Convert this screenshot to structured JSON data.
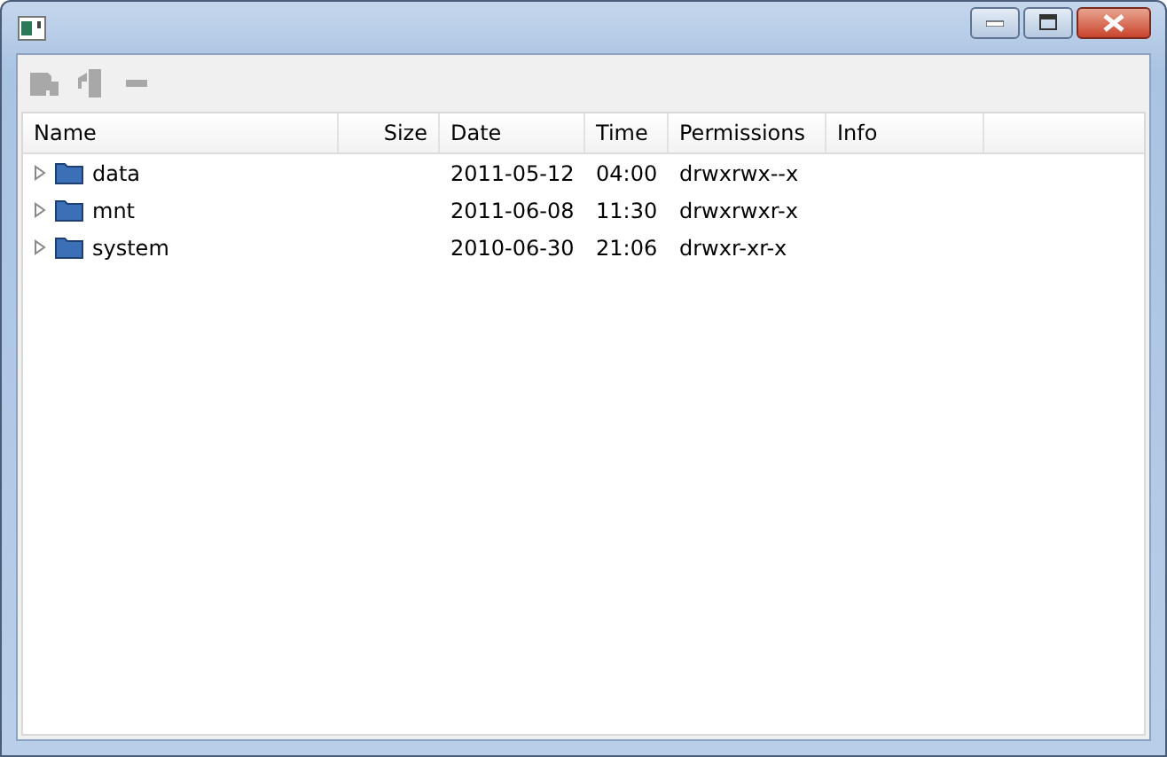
{
  "toolbar": {
    "buttons": [
      {
        "kind": "save",
        "disabled": true
      },
      {
        "kind": "device",
        "disabled": true
      },
      {
        "kind": "remove",
        "disabled": true
      }
    ]
  },
  "table": {
    "columns": [
      "Name",
      "Size",
      "Date",
      "Time",
      "Permissions",
      "Info"
    ],
    "rows": [
      {
        "name": "data",
        "size": "",
        "date": "2011-05-12",
        "time": "04:00",
        "permissions": "drwxrwx--x",
        "expanded": false
      },
      {
        "name": "mnt",
        "date": "2011-06-08",
        "time": "11:30",
        "permissions": "drwxrwxr-x",
        "expanded": false
      },
      {
        "name": "system",
        "date": "2010-06-30",
        "time": "21:06",
        "permissions": "drwxr-xr-x",
        "expanded": false
      }
    ]
  }
}
